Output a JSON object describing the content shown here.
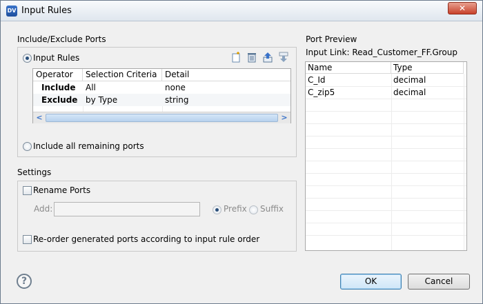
{
  "window": {
    "title": "Input Rules",
    "icon": "DV",
    "close_glyph": "✕"
  },
  "include_exclude": {
    "group_label": "Include/Exclude Ports",
    "input_rules_label": "Input Rules",
    "include_remaining_label": "Include all remaining ports",
    "toolbar": [
      "new-rule-icon",
      "delete-icon",
      "move-up-icon",
      "move-down-icon"
    ],
    "table": {
      "headers": [
        "Operator",
        "Selection Criteria",
        "Detail"
      ],
      "rows": [
        {
          "operator": "Include",
          "criteria": "All",
          "detail": "none"
        },
        {
          "operator": "Exclude",
          "criteria": "by Type",
          "detail": "string"
        }
      ]
    }
  },
  "settings": {
    "group_label": "Settings",
    "rename_ports_label": "Rename Ports",
    "add_label": "Add:",
    "add_value": "",
    "prefix_label": "Prefix",
    "suffix_label": "Suffix",
    "reorder_label": "Re-order generated ports according to input rule order"
  },
  "preview": {
    "title": "Port Preview",
    "input_link": "Input Link: Read_Customer_FF.Group",
    "headers": [
      "Name",
      "Type"
    ],
    "rows": [
      {
        "name": "C_Id",
        "type": "decimal"
      },
      {
        "name": "C_zip5",
        "type": "decimal"
      }
    ]
  },
  "buttons": {
    "ok": "OK",
    "cancel": "Cancel",
    "help": "?"
  }
}
